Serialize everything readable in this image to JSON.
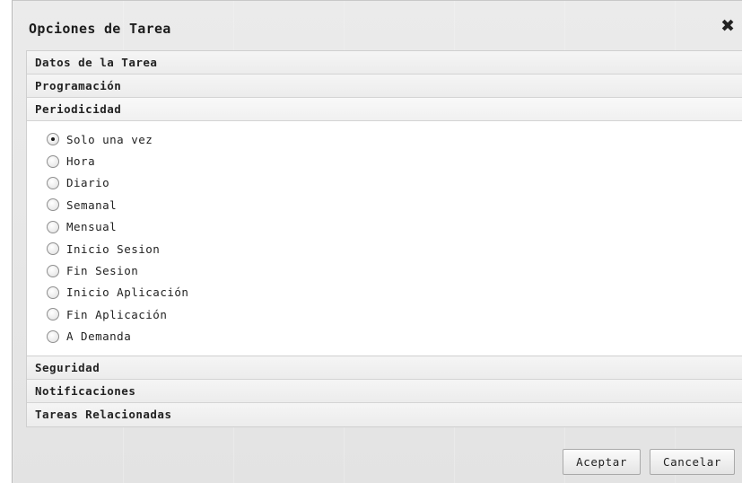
{
  "dialog": {
    "title": "Opciones de Tarea",
    "close_icon": "close-icon"
  },
  "accordion": {
    "sections": [
      {
        "label": "Datos de la Tarea"
      },
      {
        "label": "Programación"
      },
      {
        "label": "Periodicidad"
      },
      {
        "label": "Seguridad"
      },
      {
        "label": "Notificaciones"
      },
      {
        "label": "Tareas Relacionadas"
      }
    ],
    "active_section": "Periodicidad"
  },
  "periodicity": {
    "options": [
      {
        "label": "Solo una vez",
        "selected": true
      },
      {
        "label": "Hora",
        "selected": false
      },
      {
        "label": "Diario",
        "selected": false
      },
      {
        "label": "Semanal",
        "selected": false
      },
      {
        "label": "Mensual",
        "selected": false
      },
      {
        "label": "Inicio Sesion",
        "selected": false
      },
      {
        "label": "Fin Sesion",
        "selected": false
      },
      {
        "label": "Inicio Aplicación",
        "selected": false
      },
      {
        "label": "Fin Aplicación",
        "selected": false
      },
      {
        "label": "A Demanda",
        "selected": false
      }
    ]
  },
  "footer": {
    "accept_label": "Aceptar",
    "cancel_label": "Cancelar"
  }
}
